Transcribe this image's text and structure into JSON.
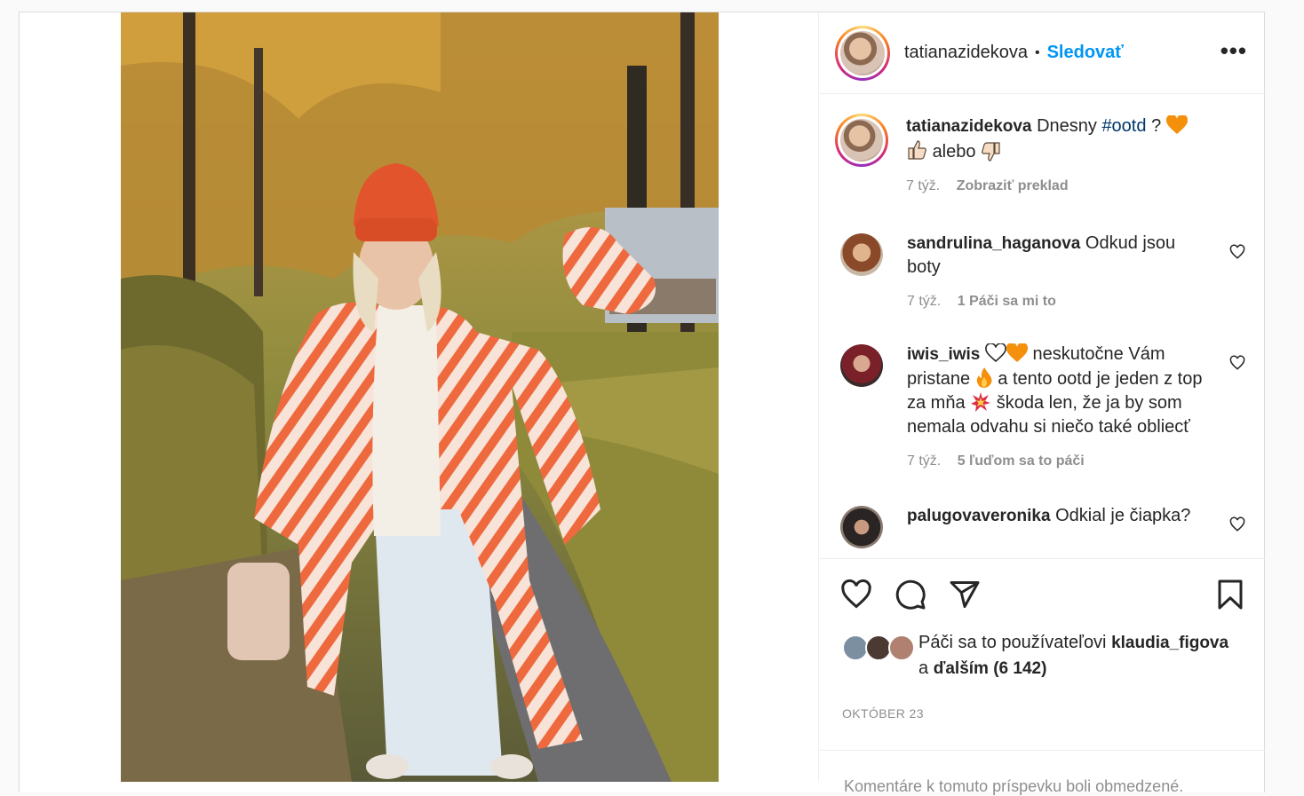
{
  "post": {
    "author": "tatianazidekova",
    "follow_label": "Sledovať",
    "separator": "•"
  },
  "caption": {
    "user": "tatianazidekova",
    "text_1": "Dnesny",
    "hashtag": "#ootd",
    "text_2": "?",
    "text_3": "alebo",
    "time": "7 týž.",
    "translate_label": "Zobraziť preklad"
  },
  "comments": [
    {
      "user": "sandrulina_haganova",
      "text": "Odkud jsou boty",
      "time": "7 týž.",
      "likes": "1 Páči sa mi to"
    },
    {
      "user": "iwis_iwis",
      "text_a": "neskutočne Vám pristane",
      "text_b": "a tento ootd je jeden z top za mňa",
      "text_c": "škoda len, že ja by som nemala odvahu si niečo také obliecť",
      "time": "7 týž.",
      "likes": "5 ľuďom sa to páči"
    },
    {
      "user": "palugovaveronika",
      "text": "Odkial je čiapka?"
    }
  ],
  "likes": {
    "prefix": "Páči sa to používateľovi",
    "user": "klaudia_figova",
    "and": "a",
    "others": "ďalším (6 142)"
  },
  "date": "OKTÓBER 23",
  "comments_closed": "Komentáre k tomuto príspevku boli obmedzené.",
  "colors": {
    "accent": "#0095f6",
    "hashtag": "#00376b",
    "secondary": "#8e8e8e"
  },
  "icons": [
    "more-icon",
    "like-icon",
    "comment-icon",
    "share-icon",
    "save-icon",
    "heart-icon",
    "orange-heart-emoji",
    "thumbs-up-emoji",
    "thumbs-down-emoji",
    "fire-emoji",
    "collision-emoji"
  ]
}
